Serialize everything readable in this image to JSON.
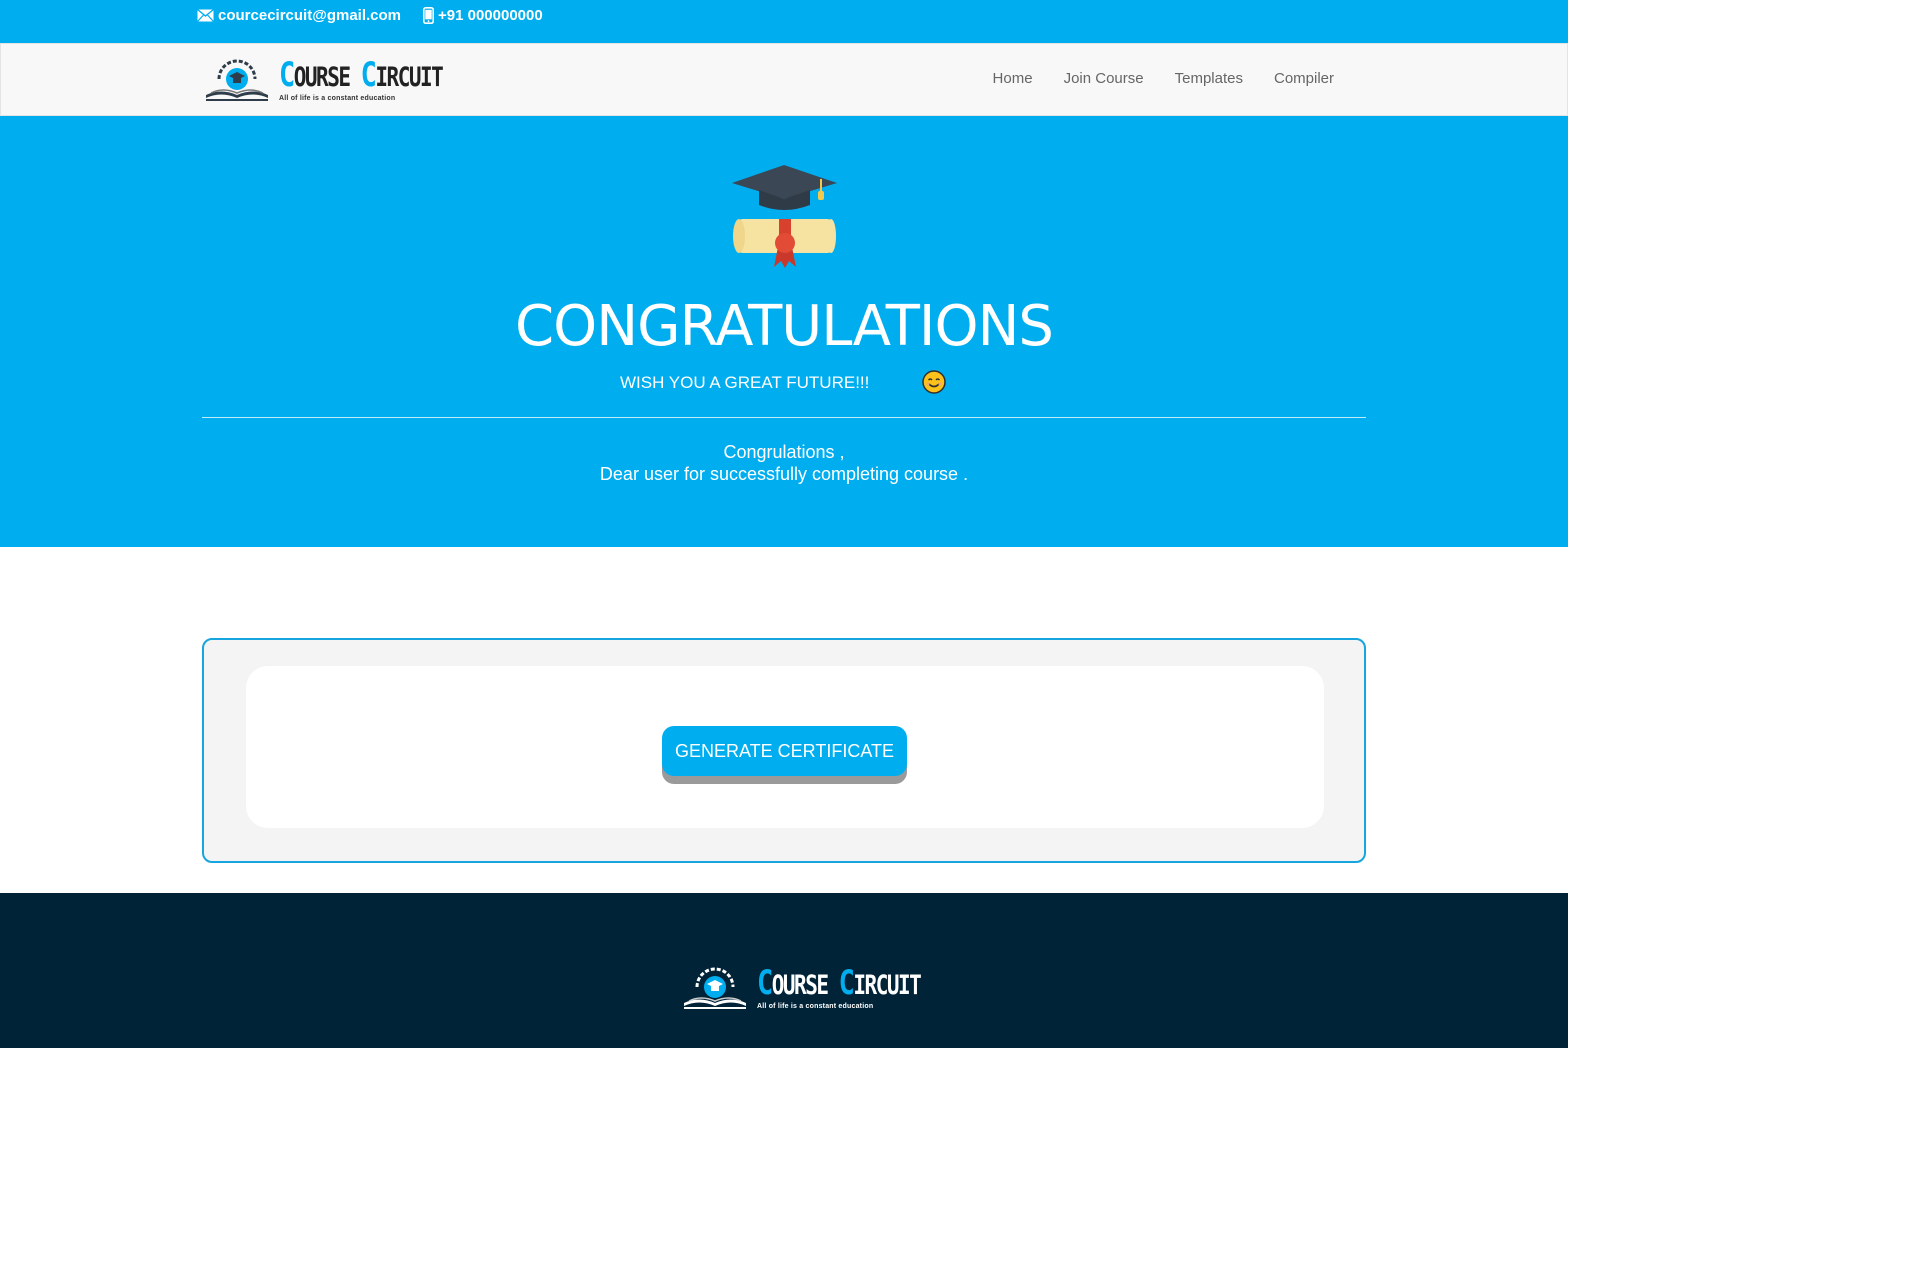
{
  "topbar": {
    "email": "courcecircuit@gmail.com",
    "phone": "+91 000000000"
  },
  "brand": {
    "name_first": "OURSE",
    "name_first_cap": "C",
    "name_second_cap": "C",
    "name_second": "IRCUIT",
    "tagline": "All of life is a constant education"
  },
  "nav": {
    "items": [
      "Home",
      "Join Course",
      "Templates",
      "Compiler"
    ]
  },
  "hero": {
    "title": "CONGRATULATIONS",
    "subtitle": "WISH YOU A GREAT FUTURE!!!",
    "message_line1": "Congrulations ,",
    "message_line2": "Dear user for successfully completing course ."
  },
  "panel": {
    "button_label": "GENERATE CERTIFICATE"
  },
  "colors": {
    "primary": "#00aeef",
    "footer": "#012338",
    "nav_bg": "#f8f8f8"
  },
  "icons": [
    "mail-icon",
    "phone-icon",
    "logo-emblem-icon",
    "graduation-cap-icon",
    "diploma-icon",
    "smiley-icon"
  ]
}
